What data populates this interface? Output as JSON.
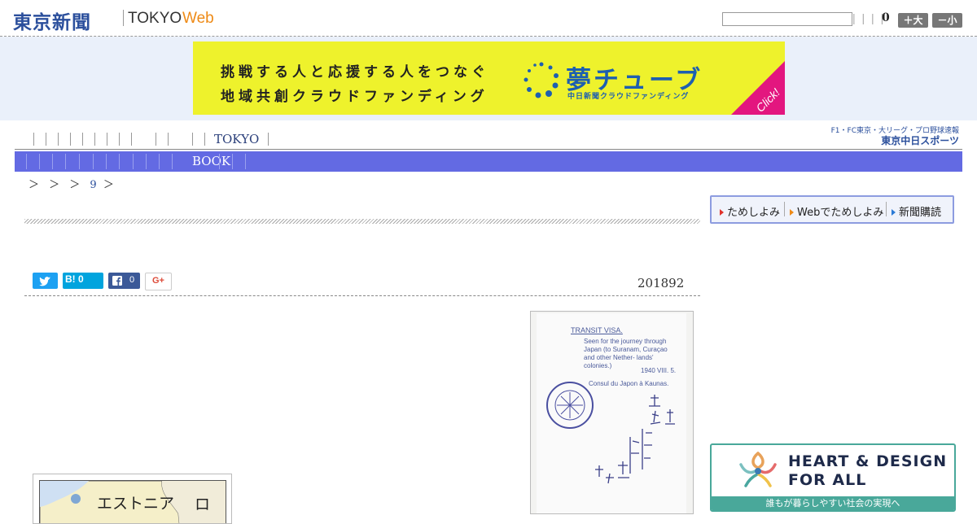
{
  "header": {
    "logo_main": "東京新聞",
    "logo_tokyo": "TOKYO",
    "logo_web": "Web",
    "search_value": "",
    "pipes": "| | | |",
    "count": "0",
    "font_bigger": "＋大",
    "font_smaller": "－小"
  },
  "banner": {
    "line1": "挑戦する人と応援する人をつなぐ",
    "line2": "地域共創クラウドファンディング",
    "brand": "夢チューブ",
    "sub": "中日新聞クラウドファンディング",
    "click": "Click!",
    "colors": {
      "background": "#eef22c",
      "brand": "#1d5fb0",
      "corner": "#e3167f"
    }
  },
  "section_nav": {
    "label": "TOKYO",
    "sports_top": "F1・FC東京・大リーグ・プロ野球速報",
    "sports_bottom": "東京中日スポーツ"
  },
  "sub_nav": {
    "book_label": "BOOK",
    "color": "#636ae3"
  },
  "breadcrumb": {
    "prefix": "＞ ＞ ＞",
    "link": "9",
    "suffix": "＞"
  },
  "side_links": [
    {
      "label": "ためしよみ",
      "arrow_color": "#e0312b"
    },
    {
      "label": "Webでためしよみ",
      "arrow_color": "#ee8a16"
    },
    {
      "label": "新聞購読",
      "arrow_color": "#2b7ad6"
    }
  ],
  "share": {
    "hatena": "B! 0",
    "facebook_count": "0",
    "gplus": "G+"
  },
  "article": {
    "date": "201892"
  },
  "visa": {
    "title": "TRANSIT VISA.",
    "body": "Seen for the journey through Japan (to Suranam, Curaçao and other Nether- lands' colonies.)",
    "date": "1940 VIII. 5.",
    "consul": "Consul du Japon à Kaunas.",
    "stamp": "CONSULAT DU JAPON KAUNAS LITHUANIE",
    "handwriting": "査証 発行"
  },
  "map": {
    "label_estonia": "エストニア",
    "label_ro": "ロ"
  },
  "heart_design": {
    "line1": "HEART & DESIGN",
    "line2": "FOR ALL",
    "bar": "誰もが暮らしやすい社会の実現へ",
    "color": "#49a89a"
  }
}
